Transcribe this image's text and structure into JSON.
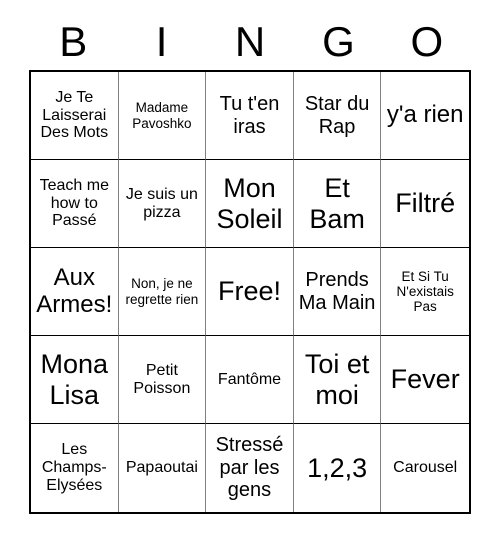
{
  "card": {
    "headers": [
      "B",
      "I",
      "N",
      "G",
      "O"
    ],
    "cells": [
      {
        "text": "Je Te Laisserai Des Mots",
        "size": "sm"
      },
      {
        "text": "Madame Pavoshko",
        "size": "xs"
      },
      {
        "text": "Tu t'en iras",
        "size": "md"
      },
      {
        "text": "Star du Rap",
        "size": "md"
      },
      {
        "text": "y'a rien",
        "size": "lg"
      },
      {
        "text": "Teach me how to Passé",
        "size": "sm"
      },
      {
        "text": "Je suis un pizza",
        "size": "sm"
      },
      {
        "text": "Mon Soleil",
        "size": "xl"
      },
      {
        "text": "Et Bam",
        "size": "xl"
      },
      {
        "text": "Filtré",
        "size": "xl"
      },
      {
        "text": "Aux Armes!",
        "size": "lg"
      },
      {
        "text": "Non, je ne regrette rien",
        "size": "xs"
      },
      {
        "text": "Free!",
        "size": "xl"
      },
      {
        "text": "Prends Ma Main",
        "size": "md"
      },
      {
        "text": "Et Si Tu N'existais Pas",
        "size": "xs"
      },
      {
        "text": "Mona Lisa",
        "size": "xl"
      },
      {
        "text": "Petit Poisson",
        "size": "sm"
      },
      {
        "text": "Fantôme",
        "size": "sm"
      },
      {
        "text": "Toi et moi",
        "size": "xl"
      },
      {
        "text": "Fever",
        "size": "xl"
      },
      {
        "text": "Les Champs-Elysées",
        "size": "sm"
      },
      {
        "text": "Papaoutai",
        "size": "sm"
      },
      {
        "text": "Stressé par les gens",
        "size": "md"
      },
      {
        "text": "1,2,3",
        "size": "xl"
      },
      {
        "text": "Carousel",
        "size": "sm"
      }
    ]
  },
  "colors": {
    "background": "#ffffff",
    "text": "#000000",
    "border_horizontal": "#000000",
    "border_vertical": "#808080"
  }
}
